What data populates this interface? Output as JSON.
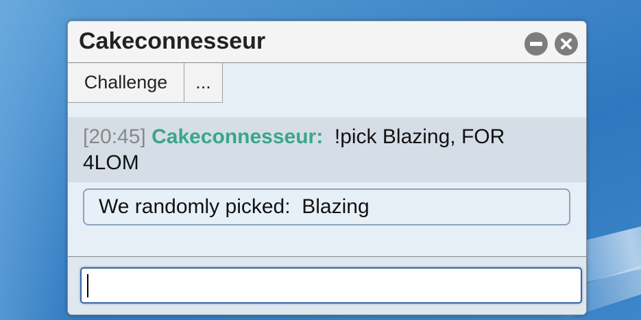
{
  "window": {
    "title": "Cakeconnesseur",
    "minimize_icon": "minimize-circle-icon",
    "close_icon": "close-circle-icon"
  },
  "tabs": [
    {
      "label": "Challenge"
    },
    {
      "label": "..."
    }
  ],
  "messages": [
    {
      "timestamp": "[20:45]",
      "user": "Cakeconnesseur:",
      "text": "!pick Blazing, FOR 4LOM"
    }
  ],
  "result_box": {
    "label": "We randomly picked:",
    "value": "Blazing"
  },
  "chat_input": {
    "value": ""
  },
  "colors": {
    "username": "#3aa688",
    "timestamp": "#888888",
    "window_bg": "#e6eef6",
    "input_border": "#3a64a8"
  }
}
